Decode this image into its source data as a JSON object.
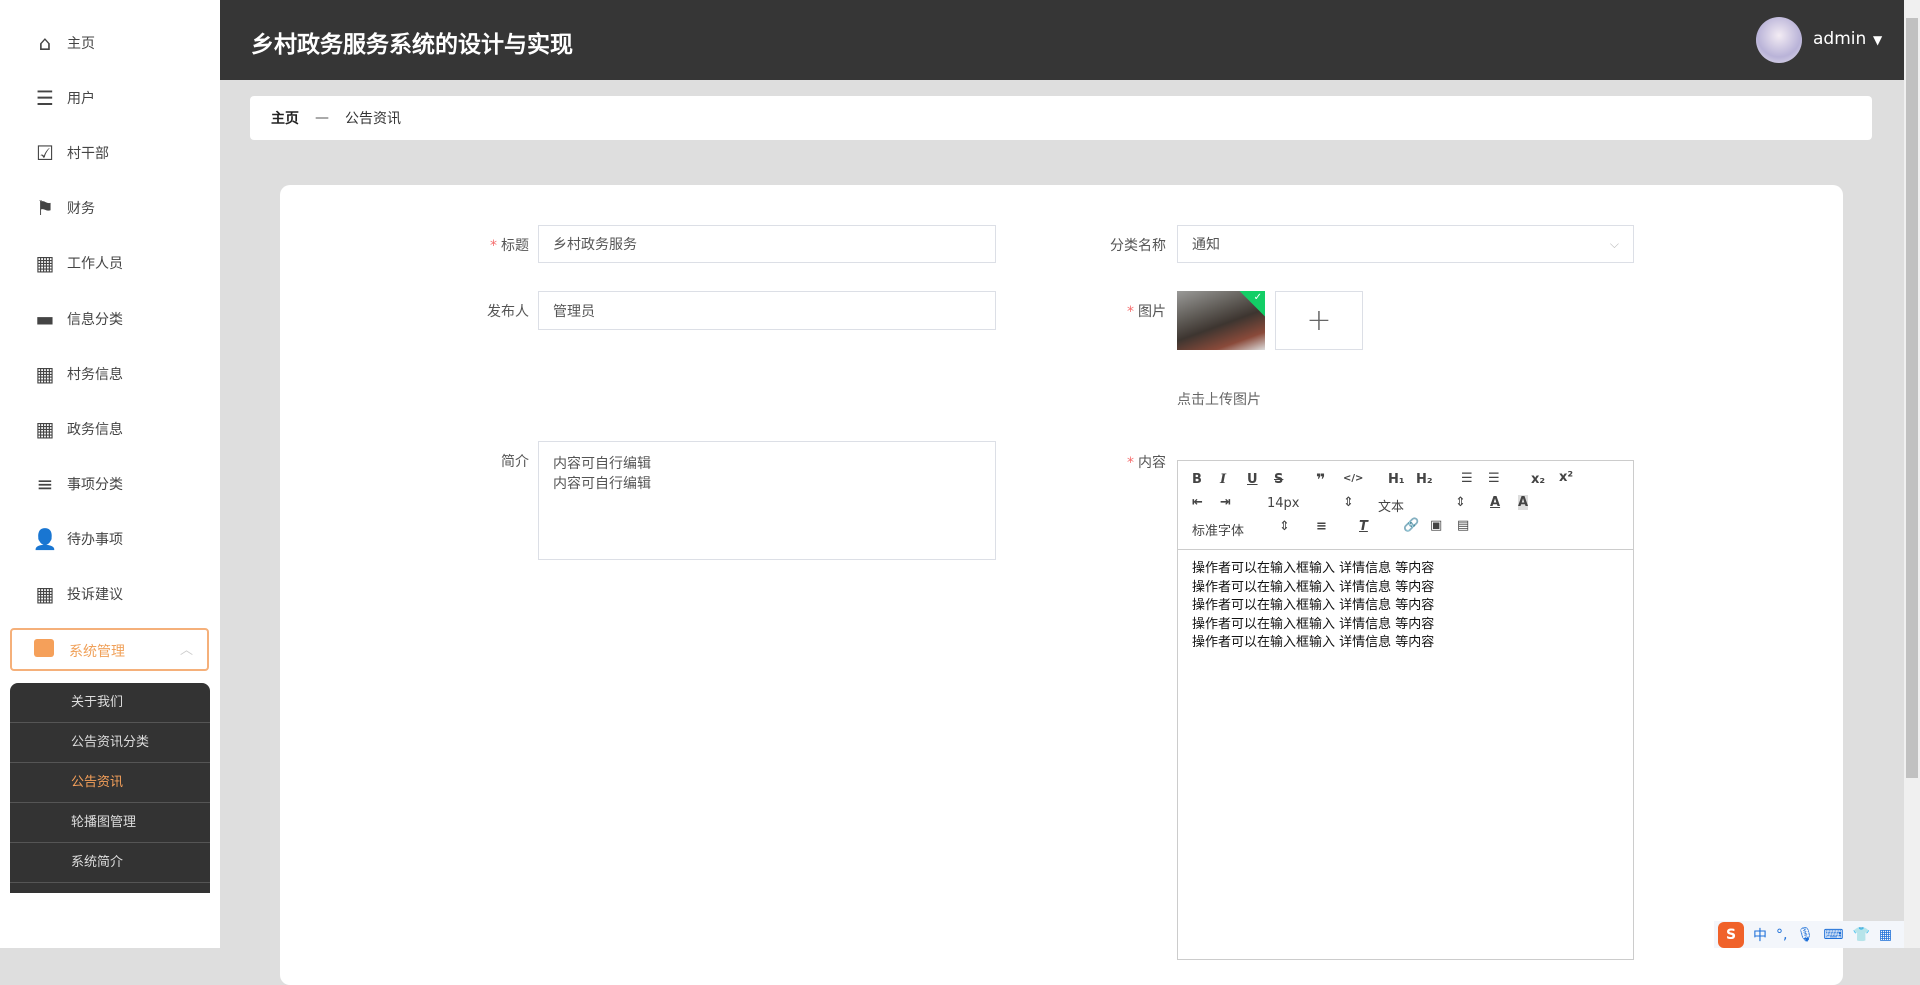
{
  "sidebar": {
    "items": [
      {
        "label": "主页",
        "icon": "home-icon"
      },
      {
        "label": "用户",
        "icon": "list-indent-icon"
      },
      {
        "label": "村干部",
        "icon": "clipboard-check-icon"
      },
      {
        "label": "财务",
        "icon": "flag-icon"
      },
      {
        "label": "工作人员",
        "icon": "grid-icon"
      },
      {
        "label": "信息分类",
        "icon": "monitor-icon"
      },
      {
        "label": "村务信息",
        "icon": "grid-icon"
      },
      {
        "label": "政务信息",
        "icon": "grid-icon"
      },
      {
        "label": "事项分类",
        "icon": "align-icon"
      },
      {
        "label": "待办事项",
        "icon": "user-icon"
      },
      {
        "label": "投诉建议",
        "icon": "grid-icon"
      }
    ],
    "system": {
      "label": "系统管理",
      "submenu": [
        "关于我们",
        "公告资讯分类",
        "公告资讯",
        "轮播图管理",
        "系统简介"
      ],
      "active": "公告资讯"
    }
  },
  "header": {
    "title": "乡村政务服务系统的设计与实现",
    "user": "admin"
  },
  "breadcrumb": {
    "home": "主页",
    "sep": "—",
    "current": "公告资讯"
  },
  "form": {
    "title_label": "标题",
    "title_value": "乡村政务服务",
    "publisher_label": "发布人",
    "publisher_value": "管理员",
    "summary_label": "简介",
    "summary_lines": [
      "内容可自行编辑",
      "内容可自行编辑"
    ],
    "category_label": "分类名称",
    "category_value": "通知",
    "image_label": "图片",
    "upload_hint": "点击上传图片",
    "plus": "+",
    "content_label": "内容",
    "toolbar": {
      "font_size": "14px",
      "text_type": "文本",
      "font_family": "标准字体"
    },
    "content_lines": [
      "操作者可以在输入框输入  详情信息  等内容",
      "操作者可以在输入框输入  详情信息  等内容",
      "操作者可以在输入框输入  详情信息  等内容",
      "操作者可以在输入框输入  详情信息  等内容",
      "操作者可以在输入框输入  详情信息  等内容"
    ]
  },
  "ime": {
    "lang": "中"
  },
  "colors": {
    "accent": "#f0a15a",
    "header": "#363636",
    "required": "#f56c6c"
  }
}
